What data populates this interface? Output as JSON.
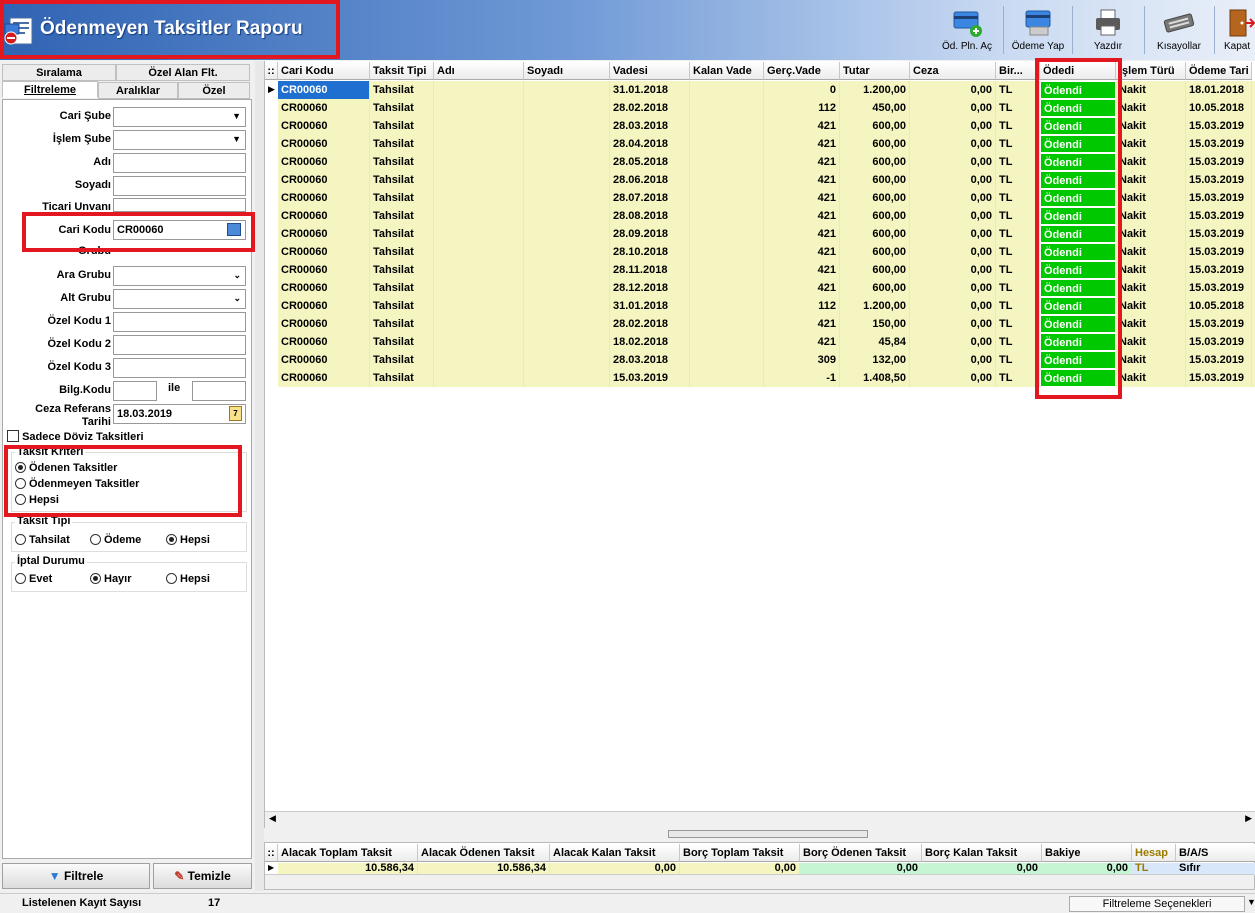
{
  "window": {
    "title": "Ödenmeyen Taksitler Raporu"
  },
  "toolbar": {
    "buttons": [
      {
        "label": "Öd. Pln. Aç",
        "icon": "card-add-icon"
      },
      {
        "label": "Ödeme Yap",
        "icon": "card-pay-icon"
      },
      {
        "label": "Yazdır",
        "icon": "printer-icon"
      },
      {
        "label": "Kısayollar",
        "icon": "keyboard-icon"
      },
      {
        "label": "Kapat",
        "icon": "exit-door-icon"
      }
    ]
  },
  "left": {
    "tabs_top": [
      "Sıralama",
      "Özel Alan Flt."
    ],
    "tabs_bottom": [
      "Filtreleme",
      "Aralıklar",
      "Özel"
    ],
    "fields": {
      "cari_sube": "Cari Şube",
      "islem_sube": "İşlem Şube",
      "adi": "Adı",
      "soyadi": "Soyadı",
      "ticari_unvani": "Ticari Unvanı",
      "cari_kodu": "Cari Kodu",
      "cari_kodu_value": "CR00060",
      "grubu": "Grubu",
      "ara_grubu": "Ara Grubu",
      "alt_grubu": "Alt Grubu",
      "ozel_kodu_1": "Özel Kodu 1",
      "ozel_kodu_2": "Özel Kodu 2",
      "ozel_kodu_3": "Özel Kodu 3",
      "bilg_kodu": "Bilg.Kodu",
      "ile": "ile",
      "ceza_ref_1": "Ceza Referans",
      "ceza_ref_2": "Tarihi",
      "ceza_ref_value": "18.03.2019"
    },
    "sadece_doviz": "Sadece Döviz Taksitleri",
    "taksit_kriteri": {
      "title": "Taksit Kriteri",
      "options": [
        "Ödenen Taksitler",
        "Ödenmeyen Taksitler",
        "Hepsi"
      ],
      "selected": 0
    },
    "taksit_tipi": {
      "title": "Taksit Tipi",
      "options": [
        "Tahsilat",
        "Ödeme",
        "Hepsi"
      ],
      "selected": 2
    },
    "iptal_durumu": {
      "title": "İptal Durumu",
      "options": [
        "Evet",
        "Hayır",
        "Hepsi"
      ],
      "selected": 1
    },
    "filtrele": "Filtrele",
    "temizle": "Temizle"
  },
  "grid": {
    "columns": [
      "Cari Kodu",
      "Taksit Tipi",
      "Adı",
      "Soyadı",
      "Vadesi",
      "Kalan Vade",
      "Gerç.Vade",
      "Tutar",
      "Ceza",
      "Bir...",
      "Ödedi",
      "İşlem Türü",
      "Ödeme Tari"
    ],
    "rows": [
      [
        "CR00060",
        "Tahsilat",
        "",
        "",
        "31.01.2018",
        "",
        "0",
        "1.200,00",
        "0,00",
        "TL",
        "Ödendi",
        "Nakit",
        "18.01.2018"
      ],
      [
        "CR00060",
        "Tahsilat",
        "",
        "",
        "28.02.2018",
        "",
        "112",
        "450,00",
        "0,00",
        "TL",
        "Ödendi",
        "Nakit",
        "10.05.2018"
      ],
      [
        "CR00060",
        "Tahsilat",
        "",
        "",
        "28.03.2018",
        "",
        "421",
        "600,00",
        "0,00",
        "TL",
        "Ödendi",
        "Nakit",
        "15.03.2019"
      ],
      [
        "CR00060",
        "Tahsilat",
        "",
        "",
        "28.04.2018",
        "",
        "421",
        "600,00",
        "0,00",
        "TL",
        "Ödendi",
        "Nakit",
        "15.03.2019"
      ],
      [
        "CR00060",
        "Tahsilat",
        "",
        "",
        "28.05.2018",
        "",
        "421",
        "600,00",
        "0,00",
        "TL",
        "Ödendi",
        "Nakit",
        "15.03.2019"
      ],
      [
        "CR00060",
        "Tahsilat",
        "",
        "",
        "28.06.2018",
        "",
        "421",
        "600,00",
        "0,00",
        "TL",
        "Ödendi",
        "Nakit",
        "15.03.2019"
      ],
      [
        "CR00060",
        "Tahsilat",
        "",
        "",
        "28.07.2018",
        "",
        "421",
        "600,00",
        "0,00",
        "TL",
        "Ödendi",
        "Nakit",
        "15.03.2019"
      ],
      [
        "CR00060",
        "Tahsilat",
        "",
        "",
        "28.08.2018",
        "",
        "421",
        "600,00",
        "0,00",
        "TL",
        "Ödendi",
        "Nakit",
        "15.03.2019"
      ],
      [
        "CR00060",
        "Tahsilat",
        "",
        "",
        "28.09.2018",
        "",
        "421",
        "600,00",
        "0,00",
        "TL",
        "Ödendi",
        "Nakit",
        "15.03.2019"
      ],
      [
        "CR00060",
        "Tahsilat",
        "",
        "",
        "28.10.2018",
        "",
        "421",
        "600,00",
        "0,00",
        "TL",
        "Ödendi",
        "Nakit",
        "15.03.2019"
      ],
      [
        "CR00060",
        "Tahsilat",
        "",
        "",
        "28.11.2018",
        "",
        "421",
        "600,00",
        "0,00",
        "TL",
        "Ödendi",
        "Nakit",
        "15.03.2019"
      ],
      [
        "CR00060",
        "Tahsilat",
        "",
        "",
        "28.12.2018",
        "",
        "421",
        "600,00",
        "0,00",
        "TL",
        "Ödendi",
        "Nakit",
        "15.03.2019"
      ],
      [
        "CR00060",
        "Tahsilat",
        "",
        "",
        "31.01.2018",
        "",
        "112",
        "1.200,00",
        "0,00",
        "TL",
        "Ödendi",
        "Nakit",
        "10.05.2018"
      ],
      [
        "CR00060",
        "Tahsilat",
        "",
        "",
        "28.02.2018",
        "",
        "421",
        "150,00",
        "0,00",
        "TL",
        "Ödendi",
        "Nakit",
        "15.03.2019"
      ],
      [
        "CR00060",
        "Tahsilat",
        "",
        "",
        "18.02.2018",
        "",
        "421",
        "45,84",
        "0,00",
        "TL",
        "Ödendi",
        "Nakit",
        "15.03.2019"
      ],
      [
        "CR00060",
        "Tahsilat",
        "",
        "",
        "28.03.2018",
        "",
        "309",
        "132,00",
        "0,00",
        "TL",
        "Ödendi",
        "Nakit",
        "15.03.2019"
      ],
      [
        "CR00060",
        "Tahsilat",
        "",
        "",
        "15.03.2019",
        "",
        "-1",
        "1.408,50",
        "0,00",
        "TL",
        "Ödendi",
        "Nakit",
        "15.03.2019"
      ]
    ]
  },
  "summary": {
    "columns": [
      "Alacak Toplam Taksit",
      "Alacak Ödenen Taksit",
      "Alacak Kalan Taksit",
      "Borç Toplam Taksit",
      "Borç Ödenen Taksit",
      "Borç Kalan Taksit",
      "Bakiye",
      "Hesap",
      "B/A/S"
    ],
    "values": [
      "10.586,34",
      "10.586,34",
      "0,00",
      "0,00",
      "0,00",
      "0,00",
      "0,00",
      "TL",
      "Sıfır"
    ]
  },
  "status": {
    "label": "Listelenen Kayıt Sayısı",
    "count": "17",
    "filter_options": "Filtreleme Seçenekleri"
  },
  "colors": {
    "odendi": "#00c800",
    "row": "#f5f5c2",
    "highlight": "#e3171f",
    "header_blue": "#2f63b3"
  }
}
